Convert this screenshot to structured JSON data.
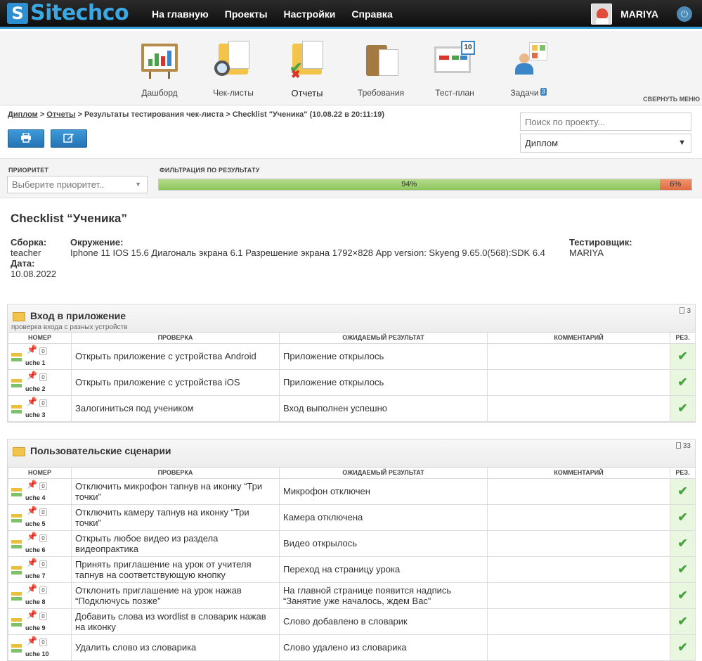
{
  "topbar": {
    "logo": "Sitechco",
    "nav": [
      "На главную",
      "Проекты",
      "Настройки",
      "Справка"
    ],
    "username": "MARIYA"
  },
  "modules": [
    {
      "label": "Дашборд",
      "icon": "dashboard-icon"
    },
    {
      "label": "Чек-листы",
      "icon": "checklists-icon"
    },
    {
      "label": "Отчеты",
      "icon": "reports-icon",
      "active": true
    },
    {
      "label": "Требования",
      "icon": "requirements-icon"
    },
    {
      "label": "Тест-план",
      "icon": "testplan-icon",
      "calendar_day": "10"
    },
    {
      "label": "Задачи",
      "icon": "tasks-icon",
      "badge": "3"
    }
  ],
  "collapse_menu": "СВЕРНУТЬ МЕНЮ",
  "breadcrumb": {
    "link1": "Диплом",
    "sep": ">",
    "link2": "Отчеты",
    "rest": "> Результаты тестирования чек-листа > Checklist \"Ученика\" (10.08.22 в 20:11:19)"
  },
  "search": {
    "placeholder": "Поиск по проекту..."
  },
  "project_select": {
    "value": "Диплом"
  },
  "filters": {
    "priority_label": "ПРИОРИТЕТ",
    "priority_placeholder": "Выберите приоритет..",
    "result_label": "ФИЛЬТРАЦИЯ ПО РЕЗУЛЬТАТУ",
    "pass_percent": 94,
    "fail_percent": 6,
    "pass_text": "94%",
    "fail_text": "6%"
  },
  "checklist": {
    "title": "Checklist “Ученика”",
    "build_label": "Сборка:",
    "build_value": "teacher",
    "date_label": "Дата:",
    "date_value": "10.08.2022",
    "env_label": "Окружение:",
    "env_value": "Iphone 11 IOS 15.6 Диагональ экрана 6.1 Разрешение экрана 1792×828 App version: Skyeng 9.65.0(568):SDK 6.4",
    "tester_label": "Тестировщик:",
    "tester_value": "MARIYA"
  },
  "columns": {
    "num": "НОМЕР",
    "check": "ПРОВЕРКА",
    "expected": "ОЖИДАЕМЫЙ РЕЗУЛЬТАТ",
    "comment": "КОММЕНТАРИЙ",
    "result": "РЕЗ."
  },
  "sections": [
    {
      "title": "Вход в приложение",
      "subtitle": "проверка входа с разных устройств",
      "count": "3",
      "rows": [
        {
          "pins": "0",
          "id": "uche 1",
          "check": "Открыть приложение с устройства Android",
          "expected": "Приложение открылось",
          "comment": "",
          "result": "✔"
        },
        {
          "pins": "0",
          "id": "uche 2",
          "check": "Открыть приложение с устройства iOS",
          "expected": "Приложение открылось",
          "comment": "",
          "result": "✔"
        },
        {
          "pins": "0",
          "id": "uche 3",
          "check": "Залогиниться под учеником",
          "expected": "Вход выполнен успешно",
          "comment": "",
          "result": "✔"
        }
      ]
    },
    {
      "title": "Пользовательские сценарии",
      "subtitle": "",
      "count": "33",
      "rows": [
        {
          "pins": "0",
          "id": "uche 4",
          "check": "Отключить микрофон тапнув на иконку “Три точки”",
          "expected": "Микрофон отключен",
          "comment": "",
          "result": "✔"
        },
        {
          "pins": "0",
          "id": "uche 5",
          "check": "Отключить камеру тапнув на иконку “Три точки”",
          "expected": "Камера отключена",
          "comment": "",
          "result": "✔"
        },
        {
          "pins": "0",
          "id": "uche 6",
          "check": "Открыть любое видео из раздела видеопрактика",
          "expected": "Видео открылось",
          "comment": "",
          "result": "✔"
        },
        {
          "pins": "0",
          "id": "uche 7",
          "check": "Принять приглашение на урок от учителя тапнув на соответствующую кнопку",
          "expected": "Переход на страницу урока",
          "comment": "",
          "result": "✔"
        },
        {
          "pins": "0",
          "id": "uche 8",
          "check": "Отклонить приглашение на урок нажав “Подключусь позже”",
          "expected": "На главной странице появится надпись “Занятие уже началось, ждем Вас”",
          "comment": "",
          "result": "✔"
        },
        {
          "pins": "0",
          "id": "uche 9",
          "check": "Добавить слова из wordlist в словарик нажав на иконку",
          "expected": "Слово добавлено в словарик",
          "comment": "",
          "result": "✔"
        },
        {
          "pins": "0",
          "id": "uche 10",
          "check": "Удалить слово из словарика",
          "expected": "Слово удалено из словарика",
          "comment": "",
          "result": "✔"
        }
      ]
    }
  ]
}
